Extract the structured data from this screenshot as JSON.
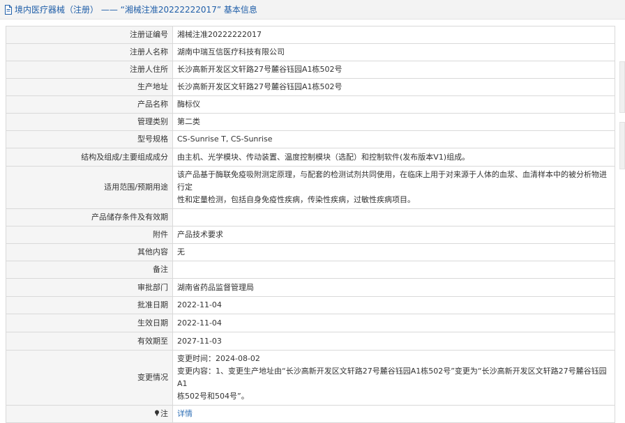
{
  "header": {
    "title": "境内医疗器械（注册） —— “湘械注准20222222017” 基本信息"
  },
  "rows": [
    {
      "label": "注册证编号",
      "lines": [
        "湘械注准20222222017"
      ]
    },
    {
      "label": "注册人名称",
      "lines": [
        "湖南中瑞互信医疗科技有限公司"
      ]
    },
    {
      "label": "注册人住所",
      "lines": [
        "长沙高新开发区文轩路27号麓谷钰园A1栋502号"
      ]
    },
    {
      "label": "生产地址",
      "lines": [
        "长沙高新开发区文轩路27号麓谷钰园A1栋502号"
      ]
    },
    {
      "label": "产品名称",
      "lines": [
        "酶标仪"
      ]
    },
    {
      "label": "管理类别",
      "lines": [
        "第二类"
      ]
    },
    {
      "label": "型号规格",
      "lines": [
        "CS-Sunrise T, CS-Sunrise"
      ]
    },
    {
      "label": "结构及组成/主要组成成分",
      "lines": [
        "由主机、光学模块、传动装置、温度控制模块（选配）和控制软件(发布版本V1)组成。"
      ]
    },
    {
      "label": "适用范围/预期用途",
      "lines": [
        "该产品基于酶联免疫吸附测定原理，与配套的检测试剂共同使用，在临床上用于对来源于人体的血浆、血清样本中的被分析物进行定",
        "性和定量检测，包括自身免疫性疾病，传染性疾病，过敏性疾病项目。"
      ]
    },
    {
      "label": "产品储存条件及有效期",
      "lines": [
        ""
      ]
    },
    {
      "label": "附件",
      "lines": [
        "产品技术要求"
      ]
    },
    {
      "label": "其他内容",
      "lines": [
        "无"
      ]
    },
    {
      "label": "备注",
      "lines": [
        ""
      ]
    },
    {
      "label": "审批部门",
      "lines": [
        "湖南省药品监督管理局"
      ]
    },
    {
      "label": "批准日期",
      "lines": [
        "2022-11-04"
      ]
    },
    {
      "label": "生效日期",
      "lines": [
        "2022-11-04"
      ]
    },
    {
      "label": "有效期至",
      "lines": [
        "2027-11-03"
      ]
    },
    {
      "label": "变更情况",
      "lines": [
        "变更时间：2024-08-02",
        "变更内容：1、变更生产地址由“长沙高新开发区文轩路27号麓谷钰园A1栋502号”变更为“长沙高新开发区文轩路27号麓谷钰园A1",
        "栋502号和504号”。"
      ]
    }
  ],
  "footer_row": {
    "label": "注",
    "link": "详情"
  },
  "colors": {
    "title": "#1f5ea8",
    "link": "#2f6fb5",
    "label_bg": "#f5f5f5",
    "border": "#d9d9d9"
  }
}
